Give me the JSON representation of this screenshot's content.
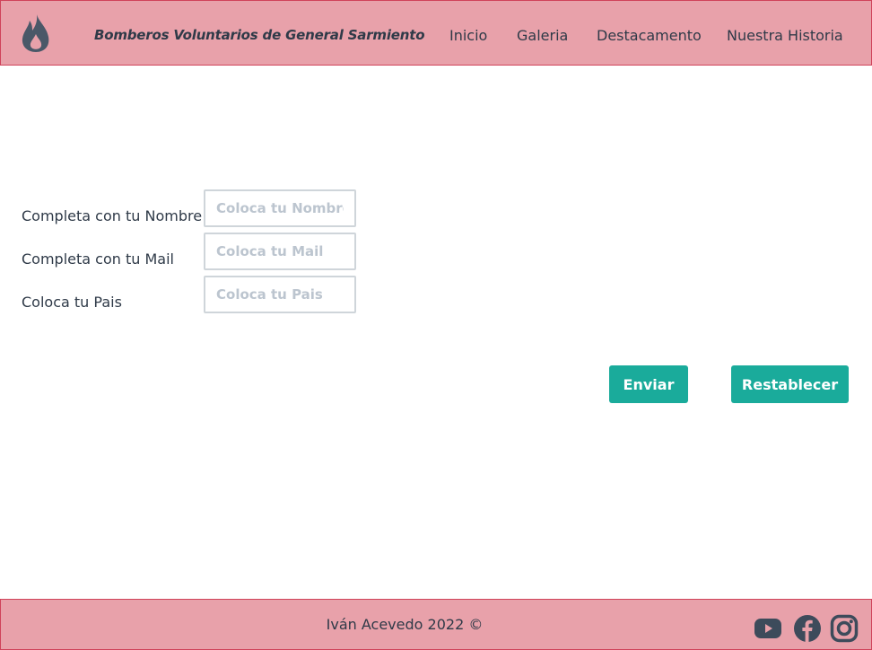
{
  "header": {
    "logo_icon": "flame-icon",
    "title": "Bomberos Voluntarios de General Sarmiento",
    "nav": [
      "Inicio",
      "Galeria",
      "Destacamento",
      "Nuestra Historia"
    ]
  },
  "form": {
    "fields": [
      {
        "label": "Completa con tu Nombre",
        "placeholder": "Coloca tu Nombre"
      },
      {
        "label": "Completa con tu Mail",
        "placeholder": "Coloca tu Mail"
      },
      {
        "label": "Coloca tu Pais",
        "placeholder": "Coloca tu Pais"
      }
    ],
    "submit_label": "Enviar",
    "reset_label": "Restablecer"
  },
  "footer": {
    "copyright": "Iván Acevedo 2022 ©",
    "social_icons": [
      "youtube-icon",
      "facebook-icon",
      "instagram-icon"
    ]
  },
  "colors": {
    "header_bg": "#e8a1aa",
    "header_border": "#d0435a",
    "button_bg": "#1aab9b",
    "text": "#2f3a48",
    "icon": "#3d4b5b"
  }
}
